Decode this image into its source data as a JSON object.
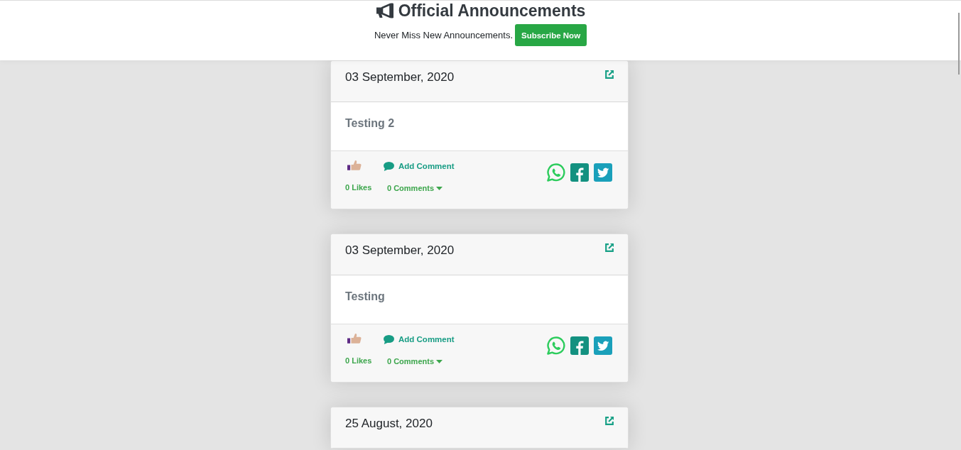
{
  "header": {
    "title": "Official Announcements",
    "tagline": "Never Miss New Announcements.",
    "subscribe_button": "Subscribe Now"
  },
  "announcements": [
    {
      "date": "03 September, 2020",
      "title": "Testing 2",
      "add_comment": "Add Comment",
      "likes": "0 Likes",
      "comments": "0 Comments"
    },
    {
      "date": "03 September, 2020",
      "title": "Testing",
      "add_comment": "Add Comment",
      "likes": "0 Likes",
      "comments": "0 Comments"
    },
    {
      "date": "25 August, 2020"
    }
  ]
}
